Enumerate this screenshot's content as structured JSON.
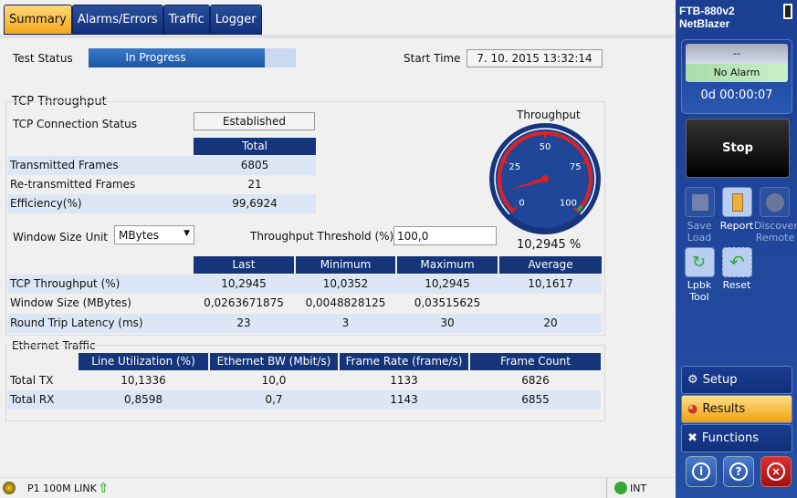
{
  "tabs": [
    "Summary",
    "Alarms/Errors",
    "Traffic",
    "Logger"
  ],
  "test_status": {
    "label": "Test Status",
    "value": "In Progress",
    "progress_percent": 85
  },
  "start_time": {
    "label": "Start Time",
    "value": "7. 10. 2015 13:32:14"
  },
  "tcp": {
    "title": "TCP Throughput",
    "conn_label": "TCP Connection Status",
    "conn_value": "Established",
    "total_header": "Total",
    "rows": [
      {
        "label": "Transmitted Frames",
        "value": "6805"
      },
      {
        "label": "Re-transmitted Frames",
        "value": "21"
      },
      {
        "label": "Efficiency(%)",
        "value": "99,6924"
      }
    ],
    "window_unit_label": "Window Size Unit",
    "window_unit_value": "MBytes",
    "threshold_label": "Throughput Threshold (%)",
    "threshold_value": "100,0",
    "stats_headers": [
      "Last",
      "Minimum",
      "Maximum",
      "Average"
    ],
    "stats_rows": [
      {
        "label": "TCP Throughput (%)",
        "values": [
          "10,2945",
          "10,0352",
          "10,2945",
          "10,1617"
        ]
      },
      {
        "label": "Window Size (MBytes)",
        "values": [
          "0,0263671875",
          "0,0048828125",
          "0,03515625",
          ""
        ]
      },
      {
        "label": "Round Trip Latency (ms)",
        "values": [
          "23",
          "3",
          "30",
          "20"
        ]
      }
    ]
  },
  "gauge": {
    "title": "Throughput",
    "ticks": [
      "0",
      "25",
      "50",
      "75",
      "100"
    ],
    "value": 10.2945,
    "min": 0,
    "max": 100,
    "readout": "10,2945 %"
  },
  "ethernet": {
    "title": "Ethernet Traffic",
    "headers": [
      "Line Utilization (%)",
      "Ethernet BW (Mbit/s)",
      "Frame Rate (frame/s)",
      "Frame Count"
    ],
    "rows": [
      {
        "label": "Total TX",
        "values": [
          "10,1336",
          "10,0",
          "1133",
          "6826"
        ]
      },
      {
        "label": "Total RX",
        "values": [
          "0,8598",
          "0,7",
          "1143",
          "6855"
        ]
      }
    ]
  },
  "sidebar": {
    "device": "FTB-880v2",
    "product": "NetBlazer",
    "alarm_top": "--",
    "alarm": "No Alarm",
    "timer": "0d 00:00:07",
    "stop": "Stop",
    "save": "Save",
    "load": "Load",
    "report": "Report",
    "discover": "Discover",
    "remote": "Remote",
    "lpbk": "Lpbk",
    "tool": "Tool",
    "reset": "Reset",
    "setup": "Setup",
    "results": "Results",
    "functions": "Functions"
  },
  "statusbar": {
    "port": "P1 100M",
    "link": "LINK",
    "clock": "INT"
  }
}
